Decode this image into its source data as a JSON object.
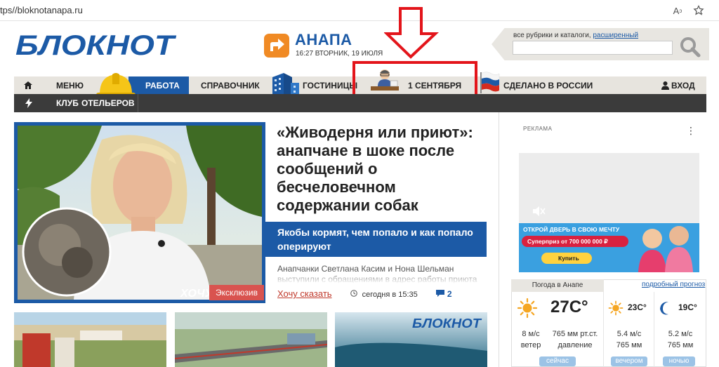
{
  "browser": {
    "url": "tps//bloknotanapa.ru",
    "reader_icon": "read-aloud-icon",
    "favorites_icon": "favorites-icon"
  },
  "header": {
    "logo_text": "БЛОКНОТ",
    "city": "АНАПА",
    "datetime": "16:27 ВТОРНИК, 19 ИЮЛЯ",
    "search_hint": "все рубрики и каталоги,",
    "search_link": "расширенный",
    "search_placeholder": ""
  },
  "nav": {
    "home_icon": "home-icon",
    "items": [
      {
        "label": "МЕНЮ"
      },
      {
        "label": "РАБОТА"
      },
      {
        "label": "СПРАВОЧНИК"
      },
      {
        "label": "ГОСТИНИЦЫ"
      },
      {
        "label": "1 СЕНТЯБРЯ"
      },
      {
        "label": "СДЕЛАНО В РОССИИ"
      },
      {
        "label": "ВХОД"
      }
    ],
    "secondary": [
      {
        "label": "КЛУБ"
      },
      {
        "label": "ОТЕЛЬЕРОВ"
      }
    ]
  },
  "main_news": {
    "title": "«Живодерня или приют»: анапчане в шоке после сообщений о бесчеловечном содержании собак",
    "subtitle": "Якобы кормят, чем попало и как попало оперируют",
    "text": "Анапчанки Светлана Касим и Нона Шельман выступили с обращениями в адрес работы приюта",
    "badge": "Эксклюзив",
    "image_caption": "ХОЧУ",
    "meta": {
      "link": "Хочу сказать",
      "time": "сегодня в 15:35",
      "comments": "2"
    }
  },
  "thumbnail_logo": "БЛОКНОТ",
  "sidebar": {
    "ad_label": "РЕКЛАМА",
    "ad_banner": {
      "headline": "ОТКРОЙ ДВЕРЬ В СВОЮ МЕЧТУ",
      "prize": "Суперприз от 700 000 000 ₽",
      "button": "Купить"
    },
    "weather": {
      "title": "Погода в Анапе",
      "link": "подробный прогноз",
      "now": {
        "temp": "27С°",
        "wind": "8 м/с",
        "wind_label": "ветер",
        "pressure": "765 мм рт.ст.",
        "pressure_label": "давление",
        "pill": "сейчас"
      },
      "evening": {
        "temp": "23С°",
        "wind": "5.4 м/с",
        "pressure": "765 мм",
        "pill": "вечером"
      },
      "night": {
        "temp": "19С°",
        "wind": "5.2 м/с",
        "pressure": "765 мм",
        "pill": "ночью"
      }
    }
  },
  "colors": {
    "brand_blue": "#1c5aa6",
    "accent_orange": "#f08a24",
    "annotation_red": "#e3151b",
    "nav_bg": "#e7e4de",
    "nav_dark": "#3b3b3b"
  }
}
